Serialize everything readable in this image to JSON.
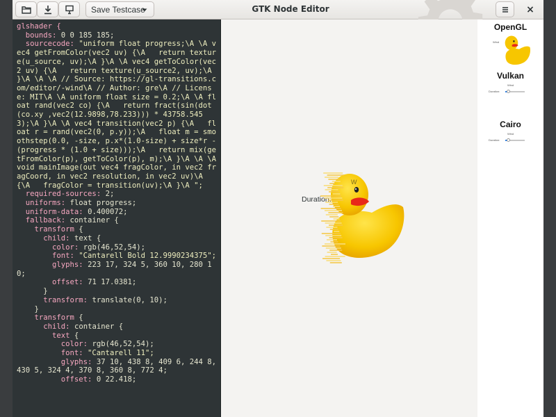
{
  "window": {
    "title": "GTK Node Editor"
  },
  "header": {
    "open_icon": "open-document-icon",
    "save_icon": "download-save-icon",
    "export_icon": "export-image-icon",
    "save_testcase_label": "Save Testcase",
    "menu_icon": "hamburger-menu-icon",
    "close_label": "×"
  },
  "code": {
    "lines": [
      [
        [
          "k",
          "glshader {"
        ]
      ],
      [
        [
          "k",
          "  bounds:"
        ],
        [
          "v",
          " 0 0 185 185;"
        ]
      ],
      [
        [
          "k",
          "  sourcecode:"
        ],
        [
          "s",
          " \"uniform float progress;\\A \\A vec4 getFromColor(vec2 uv) {\\A   return texture(u_source, uv);\\A }\\A \\A vec4 getToColor(vec2 uv) {\\A   return texture(u_source2, uv);\\A }\\A \\A \\A // Source: https://gl-transitions.com/editor/-wind\\A // Author: gre\\A // License: MIT\\A \\A uniform float size = 0.2;\\A \\A float rand(vec2 co) {\\A   return fract(sin(dot(co.xy ,vec2(12.9898,78.233))) * 43758.5453);\\A }\\A \\A vec4 transition(vec2 p) {\\A   float r = rand(vec2(0, p.y));\\A   float m = smoothstep(0.0, -size, p.x*(1.0-size) + size*r - (progress * (1.0 + size)));\\A   return mix(getFromColor(p), getToColor(p), m);\\A }\\A \\A \\A void mainImage(out vec4 fragColor, in vec2 fragCoord, in vec2 resolution, in vec2 uv)\\A {\\A   fragColor = transition(uv);\\A }\\A \";"
        ]
      ],
      [
        [
          "k",
          "  required-sources:"
        ],
        [
          "v",
          " 2;"
        ]
      ],
      [
        [
          "k",
          "  uniforms:"
        ],
        [
          "v",
          " float progress;"
        ]
      ],
      [
        [
          "k",
          "  uniform-data:"
        ],
        [
          "v",
          " 0.400072;"
        ]
      ],
      [
        [
          "k",
          "  fallback:"
        ],
        [
          "v",
          " container {"
        ]
      ],
      [
        [
          "k",
          "    transform"
        ],
        [
          "v",
          " {"
        ]
      ],
      [
        [
          "k",
          "      child:"
        ],
        [
          "v",
          " text {"
        ]
      ],
      [
        [
          "k",
          "        color:"
        ],
        [
          "v",
          " rgb(46,52,54);"
        ]
      ],
      [
        [
          "k",
          "        font:"
        ],
        [
          "s",
          " \"Cantarell Bold 12.9990234375\";"
        ]
      ],
      [
        [
          "k",
          "        glyphs:"
        ],
        [
          "v",
          " 223 17, 324 5, 360 10, 280 10;"
        ]
      ],
      [
        [
          "k",
          "        offset:"
        ],
        [
          "v",
          " 71 17.0381;"
        ]
      ],
      [
        [
          "v",
          "      }"
        ]
      ],
      [
        [
          "k",
          "      transform:"
        ],
        [
          "v",
          " translate(0, 10);"
        ]
      ],
      [
        [
          "v",
          "    }"
        ]
      ],
      [
        [
          "k",
          "    transform"
        ],
        [
          "v",
          " {"
        ]
      ],
      [
        [
          "k",
          "      child:"
        ],
        [
          "v",
          " container {"
        ]
      ],
      [
        [
          "k",
          "        text"
        ],
        [
          "v",
          " {"
        ]
      ],
      [
        [
          "k",
          "          color:"
        ],
        [
          "v",
          " rgb(46,52,54);"
        ]
      ],
      [
        [
          "k",
          "          font:"
        ],
        [
          "s",
          " \"Cantarell 11\";"
        ]
      ],
      [
        [
          "k",
          "          glyphs:"
        ],
        [
          "v",
          " 37 10, 438 8, 409 6, 244 8, 430 5, 324 4, 370 8, 360 8, 772 4;"
        ]
      ],
      [
        [
          "k",
          "          offset:"
        ],
        [
          "v",
          " 0 22.418;"
        ]
      ]
    ]
  },
  "canvas": {
    "duration_label": "Duration:",
    "title_glyph": "W"
  },
  "renderers": [
    {
      "name": "OpenGL",
      "mini_label": "Wind",
      "mini_duration": "Duration:",
      "progress": 0.4
    },
    {
      "name": "Vulkan",
      "mini_label": "Wind",
      "mini_duration": "Duration:",
      "progress": 0.15
    },
    {
      "name": "Cairo",
      "mini_label": "Wind",
      "mini_duration": "Duration:",
      "progress": 0.15
    }
  ],
  "colors": {
    "code_bg": "#2e3436",
    "accent": "#3584e4",
    "duck_yellow": "#f7c600",
    "duck_orange": "#f08a00"
  }
}
